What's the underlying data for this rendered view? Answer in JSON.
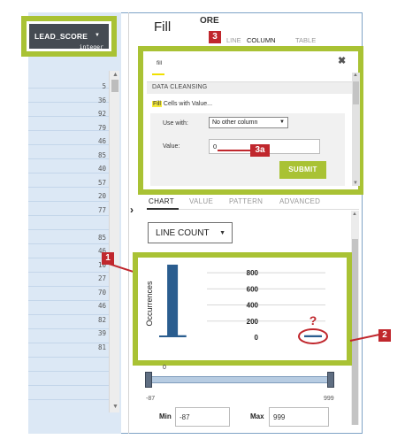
{
  "column_header": {
    "name": "LEAD_SCORE",
    "type": "integer"
  },
  "column_values": [
    "5",
    "36",
    "92",
    "79",
    "46",
    "85",
    "40",
    "57",
    "20",
    "77",
    "",
    "85",
    "46",
    "10",
    "27",
    "70",
    "46",
    "82",
    "39",
    "81"
  ],
  "transform_panel": {
    "title": "Fill",
    "tab_fragment": "ORE",
    "tabs": [
      "LINE",
      "COLUMN",
      "TABLE"
    ],
    "active_tab": "COLUMN"
  },
  "fill_dialog": {
    "search_text": "fill",
    "section_heading": "DATA CLEANSING",
    "fill_keyword": "Fill",
    "fill_rest": " Cells with Value...",
    "use_with_label": "Use with:",
    "use_with_value": "No other column",
    "value_label": "Value:",
    "value": "0",
    "submit_label": "SUBMIT"
  },
  "profile_tabs": [
    "CHART",
    "VALUE",
    "PATTERN",
    "ADVANCED"
  ],
  "active_profile_tab": "CHART",
  "line_count_select": "LINE COUNT",
  "callouts": {
    "c1": "1",
    "c2": "2",
    "c3": "3",
    "c3a": "3a"
  },
  "question_mark": "?",
  "chart_data": {
    "type": "bar",
    "ylabel": "Occurrences",
    "xlabel": "",
    "title": "",
    "yticks": [
      0,
      200,
      400,
      600,
      800
    ],
    "ylim": [
      0,
      900
    ],
    "bins": [
      {
        "x": -87,
        "value": 12
      },
      {
        "x": -35,
        "value": 900
      },
      {
        "x": 20,
        "value": 25
      },
      {
        "x": 999,
        "value": 25
      }
    ],
    "x_range": [
      -87,
      999
    ],
    "zero_label": "0"
  },
  "range": {
    "min_tick": "-87",
    "max_tick": "999",
    "min_label": "Min",
    "min_value": "-87",
    "max_label": "Max",
    "max_value": "999"
  },
  "colors": {
    "accent": "#a9c234",
    "callout": "#c0272d",
    "bar": "#2a5d8f",
    "header_bg": "#454b52"
  }
}
